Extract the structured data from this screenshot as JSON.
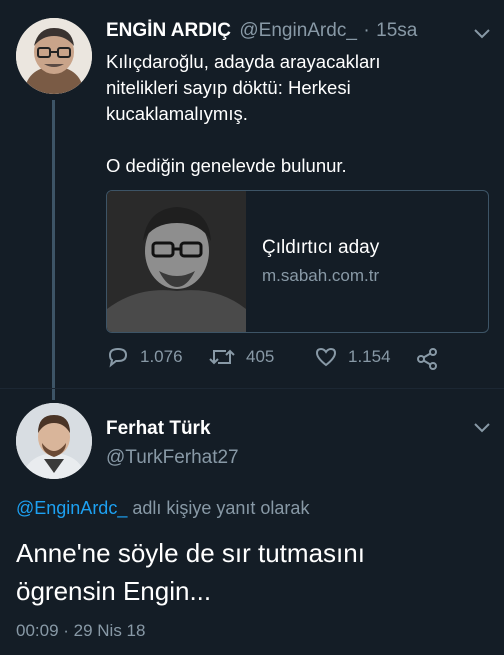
{
  "tweet1": {
    "name": "ENGİN ARDIÇ",
    "handle": "@EnginArdc_",
    "separator": "·",
    "time": "15sa",
    "text_line1": "Kılıçdaroğlu, adayda arayacakları",
    "text_line2": "nitelikleri sayıp döktü: Herkesi",
    "text_line3": "kucaklamalıymış.",
    "text_line4": "O dediğin genelevde bulunur.",
    "card": {
      "title": "Çıldırtıcı aday",
      "domain": "m.sabah.com.tr"
    },
    "actions": {
      "replies": "1.076",
      "retweets": "405",
      "likes": "1.154"
    }
  },
  "tweet2": {
    "name": "Ferhat Türk",
    "handle": "@TurkFerhat27",
    "reply_mention": "@EnginArdc_",
    "reply_suffix": "adlı kişiye yanıt olarak",
    "text_line1": "Anne'ne söyle de sır tutmasını",
    "text_line2": "ögrensin Engin...",
    "timestamp": "00:09 · 29 Nis 18"
  },
  "colors": {
    "background": "#141d26",
    "secondary_text": "#8899a6",
    "link": "#1da1f2",
    "thread_line": "#3d5466"
  },
  "icons": [
    "chevron-down-icon",
    "reply-icon",
    "retweet-icon",
    "like-icon",
    "share-icon"
  ]
}
